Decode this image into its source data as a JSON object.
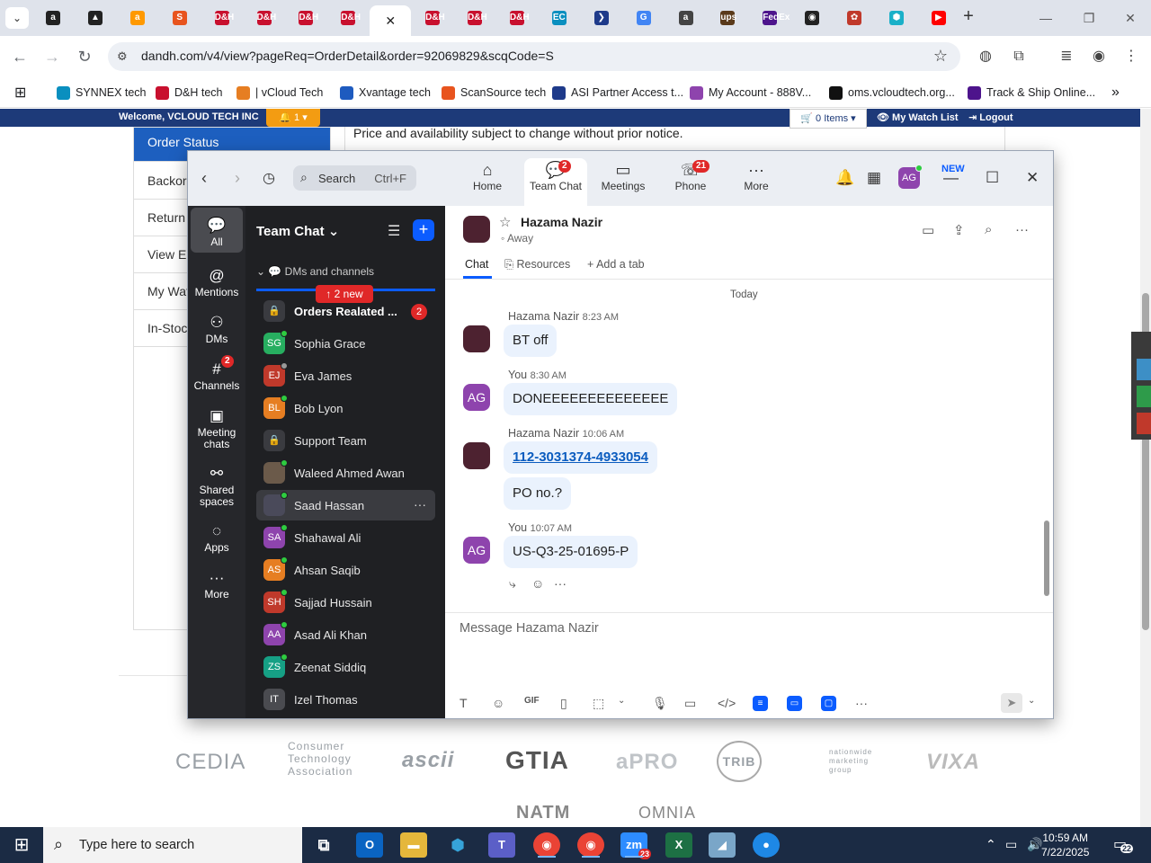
{
  "browser": {
    "url": "dandh.com/v4/view?pageReq=OrderDetail&order=92069829&scqCode=S",
    "tabs": [
      {
        "label": "a",
        "color": "#222222"
      },
      {
        "label": "▲",
        "color": "#222222"
      },
      {
        "label": "a",
        "color": "#ff9900"
      },
      {
        "label": "S",
        "color": "#e8541e"
      },
      {
        "label": "D&H",
        "color": "#c8102e"
      },
      {
        "label": "D&H",
        "color": "#c8102e"
      },
      {
        "label": "D&H",
        "color": "#c8102e"
      },
      {
        "label": "D&H",
        "color": "#c8102e"
      },
      {
        "label": "✕",
        "color": "#ffffff"
      },
      {
        "label": "D&H",
        "color": "#c8102e"
      },
      {
        "label": "D&H",
        "color": "#c8102e"
      },
      {
        "label": "D&H",
        "color": "#c8102e"
      },
      {
        "label": "EC",
        "color": "#0a8fbf"
      },
      {
        "label": "❯",
        "color": "#1e3a8a"
      },
      {
        "label": "G",
        "color": "#4285f4"
      },
      {
        "label": "a",
        "color": "#444444"
      },
      {
        "label": "ups",
        "color": "#5a3a1a"
      },
      {
        "label": "FedEx",
        "color": "#4d148c"
      },
      {
        "label": "◉",
        "color": "#222222"
      },
      {
        "label": "✿",
        "color": "#c0392b"
      },
      {
        "label": "⬢",
        "color": "#1ab0c8"
      },
      {
        "label": "▶",
        "color": "#ff0000"
      }
    ],
    "bookmarks": [
      {
        "label": "SYNNEX tech",
        "color": "#0a8fbf"
      },
      {
        "label": "D&H tech",
        "color": "#c8102e"
      },
      {
        "label": "| vCloud Tech",
        "color": "#e67e22"
      },
      {
        "label": "Xvantage tech",
        "color": "#1e5bbf"
      },
      {
        "label": "ScanSource tech",
        "color": "#e8541e"
      },
      {
        "label": "ASI Partner Access t...",
        "color": "#1e3a8a"
      },
      {
        "label": "My Account - 888V...",
        "color": "#8e44ad"
      },
      {
        "label": "oms.vcloudtech.org...",
        "color": "#111111"
      },
      {
        "label": "Track & Ship Online...",
        "color": "#4d148c"
      }
    ]
  },
  "site": {
    "welcome": "Welcome, VCLOUD TECH INC",
    "bell_count": "1",
    "cart": "0 Items",
    "watch": "My Watch List",
    "logout": "Logout",
    "notice": "Price and availability subject to change without prior notice.",
    "side_items": [
      "Order Status",
      "Backor",
      "Return",
      "View E",
      "My Wat",
      "In-Stoc"
    ],
    "footer_logos": [
      "CEDIA",
      "Consumer Technology Association",
      "ascii",
      "GTIA",
      "aPRO",
      "TRIB",
      "nationwide marketing group",
      "VIXA",
      "NATM",
      "OMNIA"
    ]
  },
  "zoom": {
    "search_label": "Search",
    "search_shortcut": "Ctrl+F",
    "nav_tabs": [
      {
        "label": "Home",
        "icon": "home-icon",
        "glyph": "⌂"
      },
      {
        "label": "Team Chat",
        "icon": "chat-icon",
        "glyph": "💬",
        "badge": "2"
      },
      {
        "label": "Meetings",
        "icon": "video-icon",
        "glyph": "▭"
      },
      {
        "label": "Phone",
        "icon": "phone-icon",
        "glyph": "☏",
        "badge": "21"
      },
      {
        "label": "More",
        "icon": "more-icon",
        "glyph": "···"
      }
    ],
    "new_label": "NEW",
    "avatar_initials": "AG",
    "rail": [
      {
        "label": "All",
        "glyph": "💬"
      },
      {
        "label": "Mentions",
        "glyph": "@"
      },
      {
        "label": "DMs",
        "glyph": "⚇"
      },
      {
        "label": "Channels",
        "glyph": "#",
        "badge": "2"
      },
      {
        "label": "Meeting chats",
        "glyph": "▣"
      },
      {
        "label": "Shared spaces",
        "glyph": "⚯"
      },
      {
        "label": "Apps",
        "glyph": "◌"
      },
      {
        "label": "More",
        "glyph": "···"
      }
    ],
    "list_title": "Team Chat",
    "section_label": "DMs and channels",
    "new_pill": "↑ 2 new",
    "contacts": [
      {
        "name": "Orders Realated ...",
        "initials": "🔒",
        "color": "#3a3b40",
        "status": "",
        "badge": "2",
        "bold": true
      },
      {
        "name": "Sophia Grace",
        "initials": "SG",
        "color": "#27ae60",
        "status": "#2ecc40"
      },
      {
        "name": "Eva James",
        "initials": "EJ",
        "color": "#c0392b",
        "status": "#999999"
      },
      {
        "name": "Bob Lyon",
        "initials": "BL",
        "color": "#e67e22",
        "status": "#2ecc40"
      },
      {
        "name": "Support Team",
        "initials": "🔒",
        "color": "#3a3b40",
        "status": ""
      },
      {
        "name": "Waleed Ahmed Awan",
        "initials": "",
        "color": "#6b5a4a",
        "status": "#2ecc40"
      },
      {
        "name": "Saad Hassan",
        "initials": "",
        "color": "#4a4a5a",
        "status": "#2ecc40",
        "active": true
      },
      {
        "name": "Shahawal Ali",
        "initials": "SA",
        "color": "#8e44ad",
        "status": "#2ecc40"
      },
      {
        "name": "Ahsan Saqib",
        "initials": "AS",
        "color": "#e67e22",
        "status": "#2ecc40"
      },
      {
        "name": "Sajjad Hussain",
        "initials": "SH",
        "color": "#c0392b",
        "status": "#2ecc40"
      },
      {
        "name": "Asad Ali Khan",
        "initials": "AA",
        "color": "#8e44ad",
        "status": "#2ecc40"
      },
      {
        "name": "Zeenat Siddiq",
        "initials": "ZS",
        "color": "#16a085",
        "status": "#2ecc40"
      },
      {
        "name": "Izel Thomas",
        "initials": "IT",
        "color": "#4a4b50",
        "status": ""
      }
    ],
    "chat": {
      "name": "Hazama Nazir",
      "status": "Away",
      "tabs": [
        "Chat",
        "Resources",
        "+ Add a tab"
      ],
      "today": "Today",
      "messages": [
        {
          "sender": "Hazama Nazir",
          "time": "8:23 AM",
          "avatar": "",
          "avatar_color": "#4d2230",
          "texts": [
            "BT off"
          ]
        },
        {
          "sender": "You",
          "time": "8:30 AM",
          "avatar": "AG",
          "avatar_color": "#8e44ad",
          "texts": [
            "DONEEEEEEEEEEEEEE"
          ]
        },
        {
          "sender": "Hazama Nazir",
          "time": "10:06 AM",
          "avatar": "",
          "avatar_color": "#4d2230",
          "texts": [
            "112-3031374-4933054",
            "PO no.?"
          ]
        },
        {
          "sender": "You",
          "time": "10:07 AM",
          "avatar": "AG",
          "avatar_color": "#8e44ad",
          "texts": [
            "US-Q3-25-01695-P"
          ]
        }
      ],
      "placeholder": "Message Hazama Nazir"
    }
  },
  "taskbar": {
    "search": "Type here to search",
    "zoom_badge": "23",
    "time": "10:59 AM",
    "date": "7/22/2025",
    "notifications": "22"
  }
}
